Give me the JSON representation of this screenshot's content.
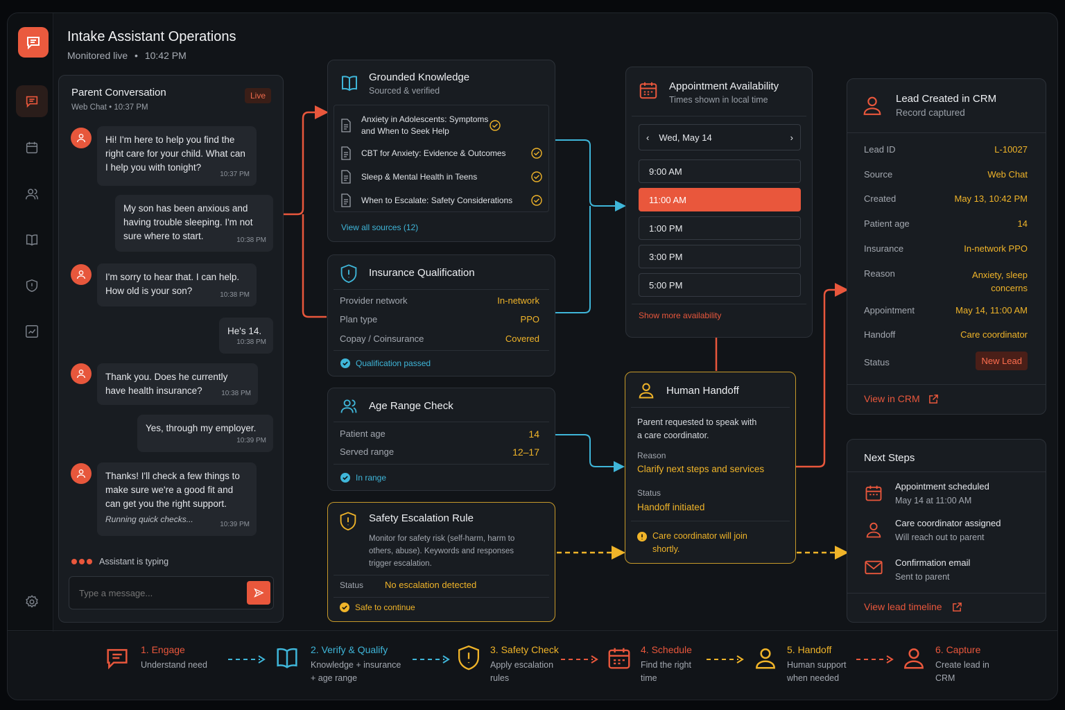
{
  "header": {
    "title": "Intake Assistant Operations",
    "status": "Monitored live",
    "separator": "•",
    "time": "10:42 PM"
  },
  "colors": {
    "accent": "#e9573c",
    "gold": "#f0b429",
    "teal": "#3fb6d9",
    "bg": "#111418"
  },
  "sidebar": {
    "items": [
      "chat-icon",
      "calendar-icon",
      "users-icon",
      "book-icon",
      "shield-icon",
      "chart-icon",
      "gear-icon"
    ]
  },
  "conversation": {
    "title": "Parent Conversation",
    "badge": "Live",
    "channel": "Web Chat • 10:37 PM",
    "messages": [
      {
        "from": "assistant",
        "text": "Hi! I'm here to help you find the right care for your child. What can I help you with tonight?",
        "time": "10:37 PM"
      },
      {
        "from": "parent",
        "text": "My son has been anxious and having trouble sleeping. I'm not sure where to start.",
        "time": "10:38 PM"
      },
      {
        "from": "assistant",
        "text": "I'm sorry to hear that. I can help. How old is your son?",
        "time": "10:38 PM"
      },
      {
        "from": "parent",
        "text": "He's 14.",
        "time": "10:38 PM"
      },
      {
        "from": "assistant",
        "text": "Thank you. Does he currently have health insurance?",
        "time": "10:38 PM"
      },
      {
        "from": "parent",
        "text": "Yes, through my employer.",
        "time": "10:39 PM"
      },
      {
        "from": "assistant",
        "text": "Thanks! I'll check a few things to make sure we're a good fit and can get you the right support.",
        "note": "Running quick checks...",
        "time": "10:39 PM"
      }
    ],
    "typing": "Assistant is typing",
    "input_placeholder": "Type a message..."
  },
  "knowledge": {
    "title": "Grounded Knowledge",
    "subtitle": "Sourced & verified",
    "docs": [
      "Anxiety in Adolescents: Symptoms and When to Seek Help",
      "CBT for Anxiety: Evidence & Outcomes",
      "Sleep & Mental Health in Teens",
      "When to Escalate: Safety Considerations"
    ],
    "link": "View all sources (12)"
  },
  "insurance": {
    "title": "Insurance Qualification",
    "rows": [
      {
        "k": "Provider network",
        "v": "In-network"
      },
      {
        "k": "Plan type",
        "v": "PPO"
      },
      {
        "k": "Copay / Coinsurance",
        "v": "Covered"
      }
    ],
    "result": "Qualification passed"
  },
  "age": {
    "title": "Age Range Check",
    "rows": [
      {
        "k": "Patient age",
        "v": "14"
      },
      {
        "k": "Served range",
        "v": "12–17"
      }
    ],
    "result": "In range"
  },
  "safety": {
    "title": "Safety Escalation Rule",
    "desc": "Monitor for safety risk (self-harm, harm to others, abuse). Keywords and responses trigger escalation.",
    "status_label": "Status",
    "status_value": "No escalation detected",
    "result": "Safe to continue"
  },
  "appointment": {
    "title": "Appointment Availability",
    "subtitle": "Times shown in local time",
    "date": "Wed, May 14",
    "slots": [
      "9:00 AM",
      "11:00 AM",
      "1:00 PM",
      "3:00 PM",
      "5:00 PM"
    ],
    "selected": "11:00 AM",
    "link": "Show more availability"
  },
  "handoff": {
    "title": "Human Handoff",
    "desc": "Parent requested to speak with a care coordinator.",
    "reason_label": "Reason",
    "reason": "Clarify next steps and services",
    "status_label": "Status",
    "status": "Handoff initiated",
    "note": "Care coordinator will join shortly."
  },
  "crm": {
    "title": "Lead Created in CRM",
    "subtitle": "Record captured",
    "rows": [
      {
        "k": "Lead ID",
        "v": "L-10027"
      },
      {
        "k": "Source",
        "v": "Web Chat"
      },
      {
        "k": "Created",
        "v": "May 13, 10:42 PM"
      },
      {
        "k": "Patient age",
        "v": "14"
      },
      {
        "k": "Insurance",
        "v": "In-network PPO"
      },
      {
        "k": "Reason",
        "v": "Anxiety, sleep concerns"
      },
      {
        "k": "Appointment",
        "v": "May 14, 11:00 AM"
      },
      {
        "k": "Handoff",
        "v": "Care coordinator"
      }
    ],
    "status_label": "Status",
    "status": "New Lead",
    "link": "View in CRM"
  },
  "next_steps": {
    "title": "Next Steps",
    "items": [
      {
        "icon": "calendar-icon",
        "title": "Appointment scheduled",
        "desc": "May 14 at 11:00 AM"
      },
      {
        "icon": "user-icon",
        "title": "Care coordinator assigned",
        "desc": "Will reach out to parent"
      },
      {
        "icon": "mail-icon",
        "title": "Confirmation email",
        "desc": "Sent to parent"
      }
    ],
    "link": "View lead timeline"
  },
  "flow": [
    {
      "name": "1. Engage",
      "desc": "Understand need"
    },
    {
      "name": "2. Verify & Qualify",
      "desc": "Knowledge + insurance + age range"
    },
    {
      "name": "3. Safety Check",
      "desc": "Apply escalation rules"
    },
    {
      "name": "4. Schedule",
      "desc": "Find the right time"
    },
    {
      "name": "5. Handoff",
      "desc": "Human support when needed"
    },
    {
      "name": "6. Capture",
      "desc": "Create lead in CRM"
    }
  ]
}
